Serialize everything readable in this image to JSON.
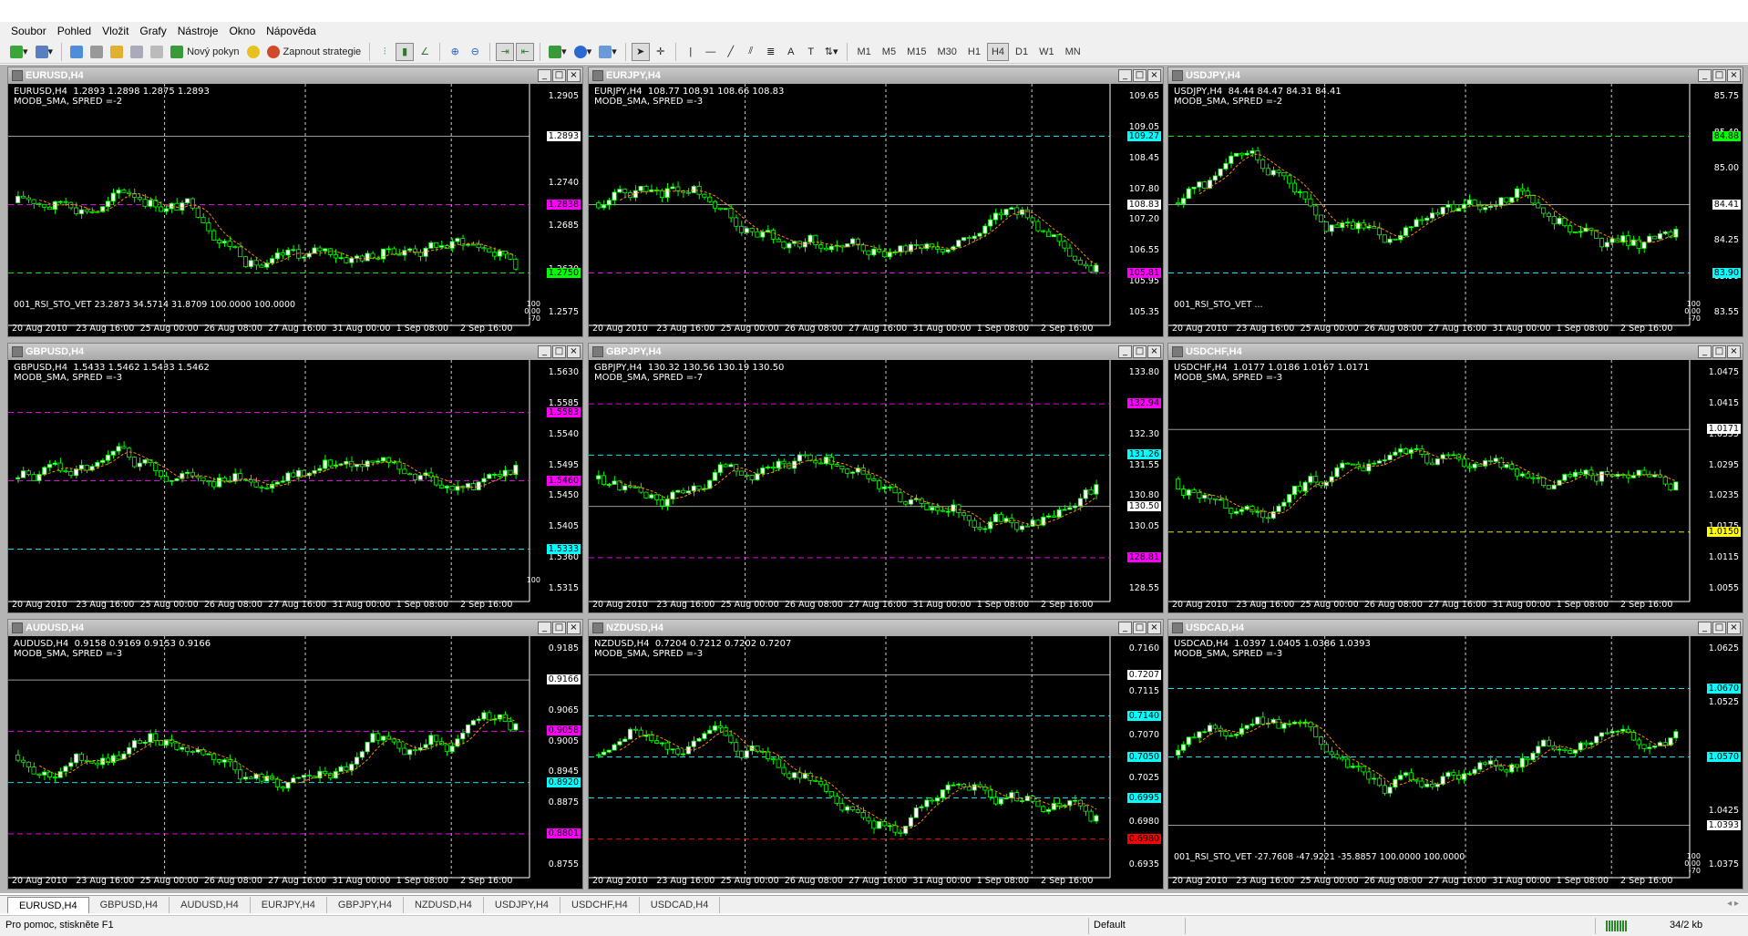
{
  "menu": [
    "Soubor",
    "Pohled",
    "Vložit",
    "Grafy",
    "Nástroje",
    "Okno",
    "Nápověda"
  ],
  "toolbar": {
    "new_order": "Nový pokyn",
    "expert": "Zapnout strategie",
    "tool_letters": [
      "A",
      "T"
    ],
    "timeframes": [
      "M1",
      "M5",
      "M15",
      "M30",
      "H1",
      "H4",
      "D1",
      "W1",
      "MN"
    ],
    "active_timeframe": "H4"
  },
  "charts": [
    {
      "title": "EURUSD,H4",
      "info1": "EURUSD,H4  1.2893 1.2898 1.2875 1.2893",
      "info2": "MODB_SMA, SPRED =-2",
      "indicator": "001_RSI_STO_VET  23.2873 34.5714 31.8709 100.0000 100.0000",
      "indicator_ticks": [
        "100",
        "0.00",
        "-70"
      ],
      "yticks": [
        "1.2905",
        "1.2795",
        "1.2740",
        "1.2685",
        "1.2630",
        "1.2575"
      ],
      "badges": [
        {
          "text": "1.2893",
          "color": "#ffffff"
        },
        {
          "text": "1.2838",
          "color": "#ff00ff"
        },
        {
          "text": "1.2750",
          "color": "#00ff00"
        }
      ],
      "xticks": [
        "20 Aug 2010",
        "23 Aug 16:00",
        "25 Aug 00:00",
        "26 Aug 08:00",
        "27 Aug 16:00",
        "31 Aug 00:00",
        "1 Sep 08:00",
        "2 Sep 16:00"
      ]
    },
    {
      "title": "EURJPY,H4",
      "info1": "EURJPY,H4  108.77 108.91 108.66 108.83",
      "info2": "MODB_SMA, SPRED =-3",
      "indicator": "",
      "indicator_ticks": [],
      "yticks": [
        "109.65",
        "109.05",
        "108.45",
        "107.80",
        "107.20",
        "106.55",
        "105.95",
        "105.35"
      ],
      "badges": [
        {
          "text": "109.27",
          "color": "#00ffff"
        },
        {
          "text": "108.83",
          "color": "#ffffff"
        },
        {
          "text": "105.81",
          "color": "#ff00ff"
        }
      ],
      "xticks": [
        "20 Aug 2010",
        "23 Aug 16:00",
        "25 Aug 00:00",
        "26 Aug 08:00",
        "27 Aug 16:00",
        "31 Aug 00:00",
        "1 Sep 08:00",
        "2 Sep 16:00"
      ]
    },
    {
      "title": "USDJPY,H4",
      "info1": "USDJPY,H4  84.44 84.47 84.31 84.41",
      "info2": "MODB_SMA, SPRED =-2",
      "indicator": "001_RSI_STO_VET  ...",
      "indicator_ticks": [
        "100",
        "0.00",
        "-70"
      ],
      "yticks": [
        "85.75",
        "85.40",
        "85.00",
        "84.65",
        "84.25",
        "83.90",
        "83.55"
      ],
      "badges": [
        {
          "text": "84.88",
          "color": "#00ff00"
        },
        {
          "text": "84.41",
          "color": "#ffffff"
        },
        {
          "text": "83.90",
          "color": "#00ffff"
        }
      ],
      "xticks": [
        "20 Aug 2010",
        "23 Aug 16:00",
        "25 Aug 00:00",
        "26 Aug 08:00",
        "27 Aug 16:00",
        "31 Aug 00:00",
        "1 Sep 08:00",
        "2 Sep 16:00"
      ]
    },
    {
      "title": "GBPUSD,H4",
      "info1": "GBPUSD,H4  1.5433 1.5462 1.5433 1.5462",
      "info2": "MODB_SMA, SPRED =-3",
      "indicator": "",
      "indicator_ticks": [
        "100"
      ],
      "yticks": [
        "1.5630",
        "1.5585",
        "1.5540",
        "1.5495",
        "1.5450",
        "1.5405",
        "1.5360",
        "1.5315"
      ],
      "badges": [
        {
          "text": "1.5583",
          "color": "#ff00ff"
        },
        {
          "text": "1.5460",
          "color": "#ff00ff"
        },
        {
          "text": "1.5333",
          "color": "#00ffff"
        }
      ],
      "xticks": [
        "20 Aug 2010",
        "23 Aug 16:00",
        "25 Aug 00:00",
        "26 Aug 08:00",
        "27 Aug 16:00",
        "31 Aug 00:00",
        "1 Sep 08:00",
        "2 Sep 16:00"
      ]
    },
    {
      "title": "GBPJPY,H4",
      "info1": "GBPJPY,H4  130.32 130.56 130.19 130.50",
      "info2": "MODB_SMA, SPRED =-7",
      "indicator": "",
      "indicator_ticks": [],
      "yticks": [
        "133.80",
        "133.05",
        "132.30",
        "131.55",
        "130.80",
        "130.05",
        "129.30",
        "128.55"
      ],
      "badges": [
        {
          "text": "132.94",
          "color": "#ff00ff"
        },
        {
          "text": "131.26",
          "color": "#00ffff"
        },
        {
          "text": "130.50",
          "color": "#ffffff"
        },
        {
          "text": "128.81",
          "color": "#ff00ff"
        }
      ],
      "xticks": [
        "20 Aug 2010",
        "23 Aug 16:00",
        "25 Aug 00:00",
        "26 Aug 08:00",
        "27 Aug 16:00",
        "31 Aug 00:00",
        "1 Sep 08:00",
        "2 Sep 16:00"
      ]
    },
    {
      "title": "USDCHF,H4",
      "info1": "USDCHF,H4  1.0177 1.0186 1.0167 1.0171",
      "info2": "MODB_SMA, SPRED =-3",
      "indicator": "",
      "indicator_ticks": [],
      "yticks": [
        "1.0475",
        "1.0415",
        "1.0355",
        "1.0295",
        "1.0235",
        "1.0175",
        "1.0115",
        "1.0055"
      ],
      "badges": [
        {
          "text": "1.0171",
          "color": "#ffffff"
        },
        {
          "text": "1.0150",
          "color": "#ffff00"
        }
      ],
      "xticks": [
        "20 Aug 2010",
        "23 Aug 16:00",
        "25 Aug 00:00",
        "26 Aug 08:00",
        "27 Aug 16:00",
        "31 Aug 00:00",
        "1 Sep 08:00",
        "2 Sep 16:00"
      ]
    },
    {
      "title": "AUDUSD,H4",
      "info1": "AUDUSD,H4  0.9158 0.9169 0.9153 0.9166",
      "info2": "MODB_SMA, SPRED =-3",
      "indicator": "",
      "indicator_ticks": [],
      "yticks": [
        "0.9185",
        "0.9125",
        "0.9065",
        "0.9005",
        "0.8945",
        "0.8875",
        "0.8815",
        "0.8755"
      ],
      "badges": [
        {
          "text": "0.9166",
          "color": "#ffffff"
        },
        {
          "text": "0.9058",
          "color": "#ff00ff"
        },
        {
          "text": "0.8920",
          "color": "#00ffff"
        },
        {
          "text": "0.8801",
          "color": "#ff00ff"
        }
      ],
      "xticks": [
        "20 Aug 2010",
        "23 Aug 16:00",
        "25 Aug 00:00",
        "26 Aug 08:00",
        "27 Aug 16:00",
        "31 Aug 00:00",
        "1 Sep 08:00",
        "2 Sep 16:00"
      ]
    },
    {
      "title": "NZDUSD,H4",
      "info1": "NZDUSD,H4  0.7204 0.7212 0.7202 0.7207",
      "info2": "MODB_SMA, SPRED =-3",
      "indicator": "",
      "indicator_ticks": [],
      "yticks": [
        "0.7160",
        "0.7115",
        "0.7070",
        "0.7025",
        "0.6980",
        "0.6935"
      ],
      "badges": [
        {
          "text": "0.7207",
          "color": "#ffffff"
        },
        {
          "text": "0.7140",
          "color": "#00ffff"
        },
        {
          "text": "0.7050",
          "color": "#00ffff"
        },
        {
          "text": "0.6995",
          "color": "#00ffff"
        },
        {
          "text": "0.6980",
          "color": "#ff0000"
        }
      ],
      "xticks": [
        "20 Aug 2010",
        "23 Aug 16:00",
        "25 Aug 00:00",
        "26 Aug 08:00",
        "27 Aug 16:00",
        "31 Aug 00:00",
        "1 Sep 08:00",
        "2 Sep 16:00"
      ]
    },
    {
      "title": "USDCAD,H4",
      "info1": "USDCAD,H4  1.0397 1.0405 1.0386 1.0393",
      "info2": "MODB_SMA, SPRED =-3",
      "indicator": "001_RSI_STO_VET  -27.7608 -47.9221 -35.8857 100.0000 100.0000",
      "indicator_ticks": [
        "100",
        "0.00",
        "-70"
      ],
      "yticks": [
        "1.0625",
        "1.0525",
        "1.0475",
        "1.0425",
        "1.0375"
      ],
      "badges": [
        {
          "text": "1.0670",
          "color": "#00ffff"
        },
        {
          "text": "1.0570",
          "color": "#00ffff"
        },
        {
          "text": "1.0393",
          "color": "#ffffff"
        }
      ],
      "xticks": [
        "20 Aug 2010",
        "23 Aug 16:00",
        "25 Aug 00:00",
        "26 Aug 08:00",
        "27 Aug 16:00",
        "31 Aug 00:00",
        "1 Sep 08:00",
        "2 Sep 16:00"
      ]
    }
  ],
  "tabs": [
    "EURUSD,H4",
    "GBPUSD,H4",
    "AUDUSD,H4",
    "EURJPY,H4",
    "GBPJPY,H4",
    "NZDUSD,H4",
    "USDJPY,H4",
    "USDCHF,H4",
    "USDCAD,H4"
  ],
  "active_tab": "EURUSD,H4",
  "status": {
    "help": "Pro pomoc, stiskněte F1",
    "profile": "Default",
    "traffic": "34/2 kb"
  },
  "colors": {
    "bull": "#ffffff",
    "bear": "#000000",
    "wick": "#00ff00",
    "ma": "#ff8c00",
    "cyan": "#00ffff",
    "magenta": "#ff00ff",
    "green": "#00ff00",
    "yellow": "#ffff00",
    "orange": "#ff8c00",
    "red": "#ff0000"
  }
}
